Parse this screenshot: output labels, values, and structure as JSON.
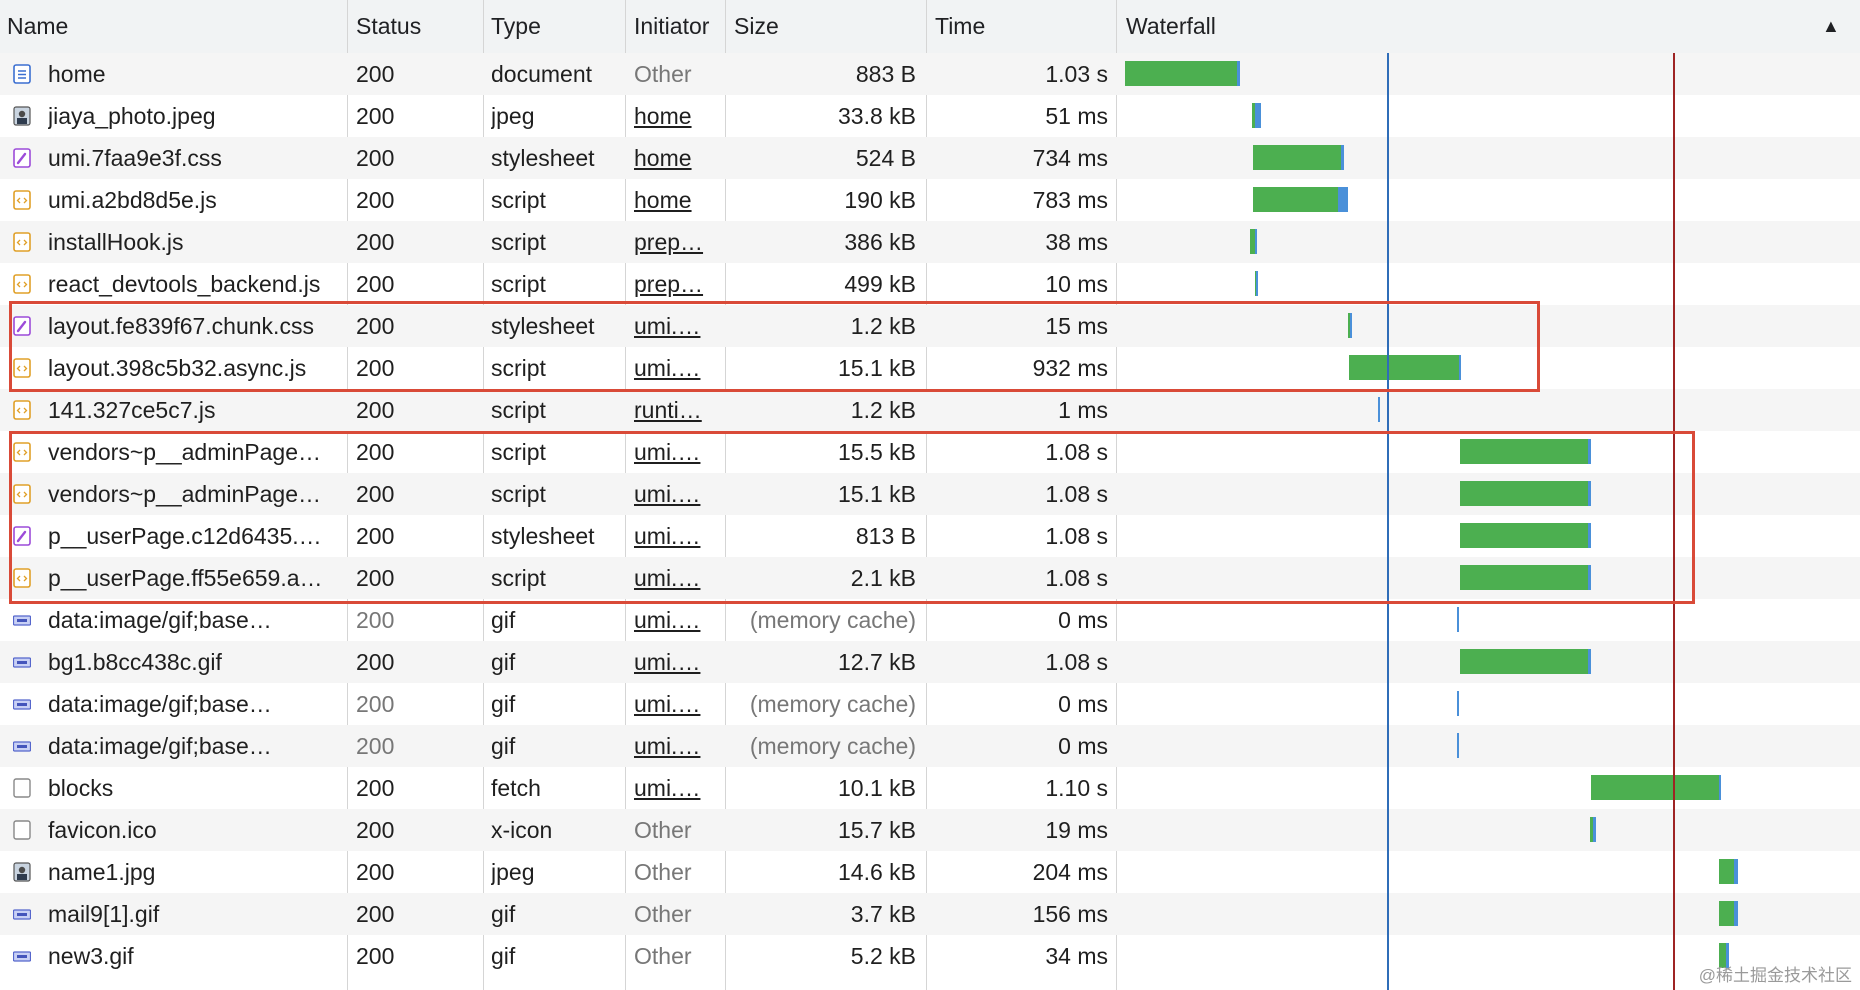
{
  "columns": {
    "name": "Name",
    "status": "Status",
    "type": "Type",
    "initiator": "Initiator",
    "size": "Size",
    "time": "Time",
    "waterfall": "Waterfall",
    "sort_indicator": "▲"
  },
  "rows": [
    {
      "name": "home",
      "status": "200",
      "type": "document",
      "initiator": "Other",
      "size": "883 B",
      "time": "1.03 s",
      "icon": "document-icon",
      "waterfall": {
        "wait": [
          0.01,
          0.16
        ],
        "recv": [
          0.16,
          0.165
        ]
      }
    },
    {
      "name": "jiaya_photo.jpeg",
      "status": "200",
      "type": "jpeg",
      "initiator": "home",
      "size": "33.8 kB",
      "time": "51 ms",
      "icon": "image-icon",
      "waterfall": {
        "wait": [
          0.18,
          0.185
        ],
        "recv": [
          0.185,
          0.193
        ]
      }
    },
    {
      "name": "umi.7faa9e3f.css",
      "status": "200",
      "type": "stylesheet",
      "initiator": "home",
      "size": "524 B",
      "time": "734 ms",
      "icon": "stylesheet-icon",
      "waterfall": {
        "wait": [
          0.182,
          0.3
        ],
        "recv": [
          0.3,
          0.304
        ]
      }
    },
    {
      "name": "umi.a2bd8d5e.js",
      "status": "200",
      "type": "script",
      "initiator": "home",
      "size": "190 kB",
      "time": "783 ms",
      "icon": "script-icon",
      "waterfall": {
        "wait": [
          0.182,
          0.297
        ],
        "recv": [
          0.297,
          0.31
        ]
      }
    },
    {
      "name": "installHook.js",
      "status": "200",
      "type": "script",
      "initiator": "prep…",
      "size": "386 kB",
      "time": "38 ms",
      "icon": "script-icon",
      "waterfall": {
        "wait": [
          0.178,
          0.184
        ],
        "recv": [
          0.184,
          0.187
        ]
      }
    },
    {
      "name": "react_devtools_backend.js",
      "status": "200",
      "type": "script",
      "initiator": "prep…",
      "size": "499 kB",
      "time": "10 ms",
      "icon": "script-icon",
      "waterfall": {
        "wait": [
          0.185,
          0.186
        ],
        "recv": [
          0.186,
          0.189
        ]
      }
    },
    {
      "name": "layout.fe839f67.chunk.css",
      "status": "200",
      "type": "stylesheet",
      "initiator": "umi.…",
      "size": "1.2 kB",
      "time": "15 ms",
      "icon": "stylesheet-icon",
      "waterfall": {
        "wait": [
          0.31,
          0.313
        ],
        "recv": [
          0.313,
          0.316
        ]
      }
    },
    {
      "name": "layout.398c5b32.async.js",
      "status": "200",
      "type": "script",
      "initiator": "umi.…",
      "size": "15.1 kB",
      "time": "932 ms",
      "icon": "script-icon",
      "waterfall": {
        "wait": [
          0.311,
          0.459
        ],
        "recv": [
          0.459,
          0.462
        ]
      }
    },
    {
      "name": "141.327ce5c7.js",
      "status": "200",
      "type": "script",
      "initiator": "runti…",
      "size": "1.2 kB",
      "time": "1 ms",
      "icon": "script-icon",
      "waterfall": {
        "wait": [
          0.35,
          0.35
        ],
        "recv": [
          0.35,
          0.353
        ]
      }
    },
    {
      "name": "vendors~p__adminPage…",
      "status": "200",
      "type": "script",
      "initiator": "umi.…",
      "size": "15.5 kB",
      "time": "1.08 s",
      "icon": "script-icon",
      "waterfall": {
        "wait": [
          0.461,
          0.634
        ],
        "recv": [
          0.634,
          0.637
        ]
      }
    },
    {
      "name": "vendors~p__adminPage…",
      "status": "200",
      "type": "script",
      "initiator": "umi.…",
      "size": "15.1 kB",
      "time": "1.08 s",
      "icon": "script-icon",
      "waterfall": {
        "wait": [
          0.461,
          0.634
        ],
        "recv": [
          0.634,
          0.637
        ]
      }
    },
    {
      "name": "p__userPage.c12d6435.…",
      "status": "200",
      "type": "stylesheet",
      "initiator": "umi.…",
      "size": "813 B",
      "time": "1.08 s",
      "icon": "stylesheet-icon",
      "waterfall": {
        "wait": [
          0.461,
          0.634
        ],
        "recv": [
          0.634,
          0.637
        ]
      }
    },
    {
      "name": "p__userPage.ff55e659.a…",
      "status": "200",
      "type": "script",
      "initiator": "umi.…",
      "size": "2.1 kB",
      "time": "1.08 s",
      "icon": "script-icon",
      "waterfall": {
        "wait": [
          0.461,
          0.634
        ],
        "recv": [
          0.634,
          0.637
        ]
      }
    },
    {
      "name": "data:image/gif;base…",
      "status": "200",
      "type": "gif",
      "initiator": "umi.…",
      "size": "(memory cache)",
      "time": "0 ms",
      "icon": "gif-icon",
      "muted": true,
      "waterfall": {
        "wait": [
          0.457,
          0.457
        ],
        "recv": [
          0.457,
          0.46
        ]
      }
    },
    {
      "name": "bg1.b8cc438c.gif",
      "status": "200",
      "type": "gif",
      "initiator": "umi.…",
      "size": "12.7 kB",
      "time": "1.08 s",
      "icon": "gif-icon",
      "waterfall": {
        "wait": [
          0.461,
          0.634
        ],
        "recv": [
          0.634,
          0.638
        ]
      }
    },
    {
      "name": "data:image/gif;base…",
      "status": "200",
      "type": "gif",
      "initiator": "umi.…",
      "size": "(memory cache)",
      "time": "0 ms",
      "icon": "gif-icon",
      "muted": true,
      "waterfall": {
        "wait": [
          0.457,
          0.457
        ],
        "recv": [
          0.457,
          0.46
        ]
      }
    },
    {
      "name": "data:image/gif;base…",
      "status": "200",
      "type": "gif",
      "initiator": "umi.…",
      "size": "(memory cache)",
      "time": "0 ms",
      "icon": "gif-icon",
      "muted": true,
      "waterfall": {
        "wait": [
          0.457,
          0.457
        ],
        "recv": [
          0.457,
          0.46
        ]
      }
    },
    {
      "name": "blocks",
      "status": "200",
      "type": "fetch",
      "initiator": "umi.…",
      "size": "10.1 kB",
      "time": "1.10 s",
      "icon": "fetch-icon",
      "waterfall": {
        "wait": [
          0.637,
          0.81
        ],
        "recv": [
          0.81,
          0.813
        ]
      }
    },
    {
      "name": "favicon.ico",
      "status": "200",
      "type": "x-icon",
      "initiator": "Other",
      "size": "15.7 kB",
      "time": "19 ms",
      "icon": "fetch-icon",
      "waterfall": {
        "wait": [
          0.636,
          0.64
        ],
        "recv": [
          0.64,
          0.644
        ]
      }
    },
    {
      "name": "name1.jpg",
      "status": "200",
      "type": "jpeg",
      "initiator": "Other",
      "size": "14.6 kB",
      "time": "204 ms",
      "icon": "image-icon",
      "waterfall": {
        "wait": [
          0.81,
          0.83
        ],
        "recv": [
          0.83,
          0.835
        ]
      }
    },
    {
      "name": "mail9[1].gif",
      "status": "200",
      "type": "gif",
      "initiator": "Other",
      "size": "3.7 kB",
      "time": "156 ms",
      "icon": "gif-icon",
      "waterfall": {
        "wait": [
          0.81,
          0.83
        ],
        "recv": [
          0.83,
          0.835
        ]
      }
    },
    {
      "name": "new3.gif",
      "status": "200",
      "type": "gif",
      "initiator": "Other",
      "size": "5.2 kB",
      "time": "34 ms",
      "icon": "gif-icon",
      "waterfall": {
        "wait": [
          0.81,
          0.819
        ],
        "recv": [
          0.819,
          0.823
        ]
      }
    }
  ],
  "colors": {
    "waiting": "#4caf50",
    "receiving": "#4a90d9",
    "dom_content_loaded": "#2f6db8",
    "load": "#9e2424",
    "highlight": "#d94a38"
  },
  "watermark": "@稀土掘金技术社区"
}
